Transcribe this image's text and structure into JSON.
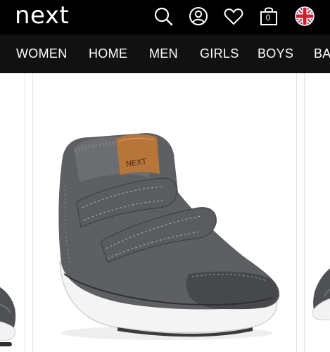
{
  "header": {
    "logo_text": "next",
    "bag_count": "0",
    "icons": [
      "search-icon",
      "account-icon",
      "favourites-icon",
      "bag-icon",
      "uk-flag-icon"
    ]
  },
  "nav": {
    "categories": [
      "WOMEN",
      "HOME",
      "MEN",
      "GIRLS",
      "BOYS",
      "BA"
    ]
  },
  "product": {
    "image": "grey-toddler-boot-with-two-touch-fastening-straps",
    "tag_text": "NEXT"
  },
  "colors": {
    "header_bg": "#000000",
    "nav_bg": "#111111",
    "text_on_dark": "#ffffff",
    "boot_grey": "#5d5f62",
    "sole_white": "#f2f2f2",
    "tag_tan": "#b8753a"
  }
}
